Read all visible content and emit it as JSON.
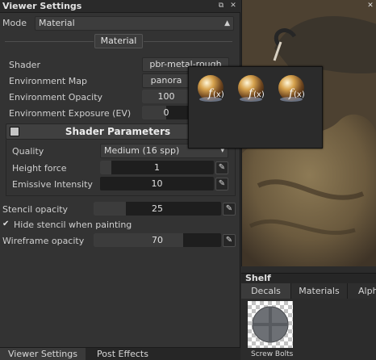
{
  "panel": {
    "title": "Viewer Settings",
    "mode": {
      "label": "Mode",
      "value": "Material"
    },
    "material_button": "Material",
    "shader": {
      "label": "Shader",
      "value": "pbr-metal-rough"
    },
    "environment_map": {
      "label": "Environment Map",
      "value": "panora"
    },
    "environment_opacity": {
      "label": "Environment Opacity",
      "value": "100",
      "fraction": 1.0
    },
    "environment_exposure": {
      "label": "Environment Exposure (EV)",
      "value": "0",
      "fraction": 0.5
    },
    "shader_parameters": {
      "title": "Shader Parameters",
      "quality": {
        "label": "Quality",
        "value": "Medium (16 spp)"
      },
      "height_force": {
        "label": "Height force",
        "value": "1",
        "fraction": 0.1
      },
      "emissive_intensity": {
        "label": "Emissive Intensity",
        "value": "10",
        "fraction": 0.0
      }
    },
    "stencil_opacity": {
      "label": "Stencil opacity",
      "value": "25",
      "fraction": 0.25
    },
    "hide_stencil": {
      "label": "Hide stencil when painting",
      "checked": true
    },
    "wireframe_opacity": {
      "label": "Wireframe opacity",
      "value": "70",
      "fraction": 0.7
    }
  },
  "bottom_tabs": [
    {
      "label": "Viewer Settings",
      "active": true
    },
    {
      "label": "Post Effects",
      "active": false
    }
  ],
  "shelf": {
    "title": "Shelf",
    "tabs": [
      {
        "label": "Decals",
        "active": true
      },
      {
        "label": "Materials",
        "active": false
      },
      {
        "label": "Alph",
        "active": false
      }
    ],
    "item_label": "Screw Bolts"
  },
  "popup": {
    "items": [
      {
        "icon": "fx-sphere-icon"
      },
      {
        "icon": "fx-sphere-icon"
      },
      {
        "icon": "fx-sphere-icon"
      }
    ]
  },
  "colors": {
    "panel_bg": "#333333",
    "slider_bg": "#1e1e1e",
    "slider_fill": "#3c3c3c",
    "text": "#c8c8c8"
  }
}
